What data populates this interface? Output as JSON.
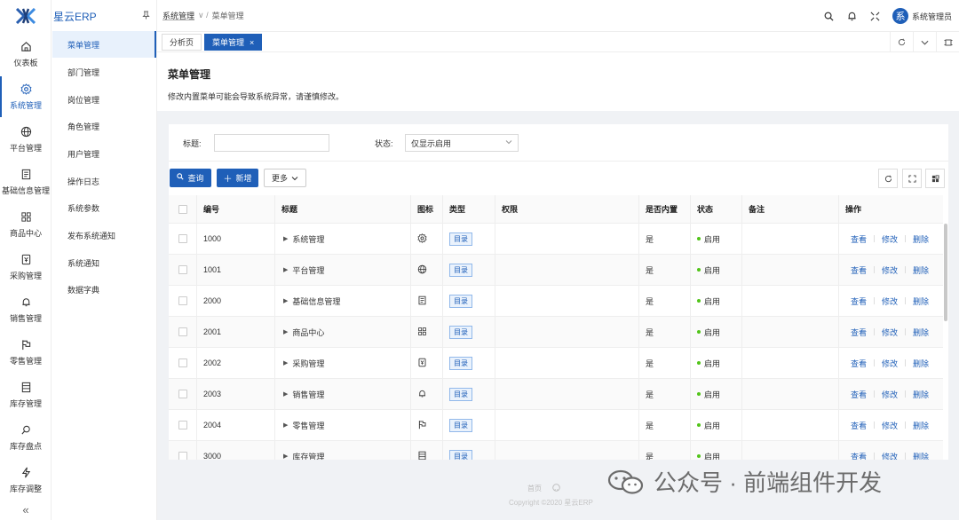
{
  "brand": {
    "name": "星云ERP"
  },
  "colors": {
    "primary": "#1f5fb8",
    "status_ok": "#52c41a"
  },
  "rail": [
    {
      "label": "仪表板",
      "icon": "home-icon"
    },
    {
      "label": "系统管理",
      "icon": "gear-icon"
    },
    {
      "label": "平台管理",
      "icon": "globe-icon"
    },
    {
      "label": "基础信息管理",
      "icon": "document-icon"
    },
    {
      "label": "商品中心",
      "icon": "grid-icon"
    },
    {
      "label": "采购管理",
      "icon": "purchase-icon"
    },
    {
      "label": "销售管理",
      "icon": "bell-icon"
    },
    {
      "label": "零售管理",
      "icon": "flag-icon"
    },
    {
      "label": "库存管理",
      "icon": "list-icon"
    },
    {
      "label": "库存盘点",
      "icon": "search-doc-icon"
    },
    {
      "label": "库存调整",
      "icon": "bolt-icon"
    }
  ],
  "submenu": [
    "菜单管理",
    "部门管理",
    "岗位管理",
    "角色管理",
    "用户管理",
    "操作日志",
    "系统参数",
    "发布系统通知",
    "系统通知",
    "数据字典"
  ],
  "breadcrumb": {
    "first": "系统管理",
    "second": "菜单管理"
  },
  "user": {
    "avatar": "系",
    "name": "系统管理员"
  },
  "tabs": {
    "first": "分析页",
    "active": "菜单管理"
  },
  "page": {
    "title": "菜单管理",
    "description": "修改内置菜单可能会导致系统异常，请谨慎修改。"
  },
  "filter": {
    "title_label": "标题:",
    "title_value": "",
    "status_label": "状态:",
    "status_value": "仅显示启用"
  },
  "toolbar": {
    "query": "查询",
    "add": "新增",
    "more": "更多"
  },
  "table": {
    "headers": {
      "code": "编号",
      "title": "标题",
      "icon": "图标",
      "type": "类型",
      "perm": "权限",
      "builtin": "是否内置",
      "status": "状态",
      "remark": "备注",
      "action": "操作"
    },
    "rows": [
      {
        "code": "1000",
        "title": "系统管理",
        "icon": "gear-icon",
        "type": "目录",
        "builtin": "是",
        "status": "启用"
      },
      {
        "code": "1001",
        "title": "平台管理",
        "icon": "globe-icon",
        "type": "目录",
        "builtin": "是",
        "status": "启用"
      },
      {
        "code": "2000",
        "title": "基础信息管理",
        "icon": "document-icon",
        "type": "目录",
        "builtin": "是",
        "status": "启用"
      },
      {
        "code": "2001",
        "title": "商品中心",
        "icon": "grid-icon",
        "type": "目录",
        "builtin": "是",
        "status": "启用"
      },
      {
        "code": "2002",
        "title": "采购管理",
        "icon": "purchase-icon",
        "type": "目录",
        "builtin": "是",
        "status": "启用"
      },
      {
        "code": "2003",
        "title": "销售管理",
        "icon": "bell-icon",
        "type": "目录",
        "builtin": "是",
        "status": "启用"
      },
      {
        "code": "2004",
        "title": "零售管理",
        "icon": "flag-icon",
        "type": "目录",
        "builtin": "是",
        "status": "启用"
      },
      {
        "code": "3000",
        "title": "库存管理",
        "icon": "list-icon",
        "type": "目录",
        "builtin": "是",
        "status": "启用"
      }
    ],
    "actions": {
      "view": "查看",
      "edit": "修改",
      "delete": "删除"
    }
  },
  "footer": {
    "home": "首页",
    "copyright": "Copyright ©2020 星云ERP"
  },
  "watermark": {
    "text": "公众号 · 前端组件开发"
  }
}
